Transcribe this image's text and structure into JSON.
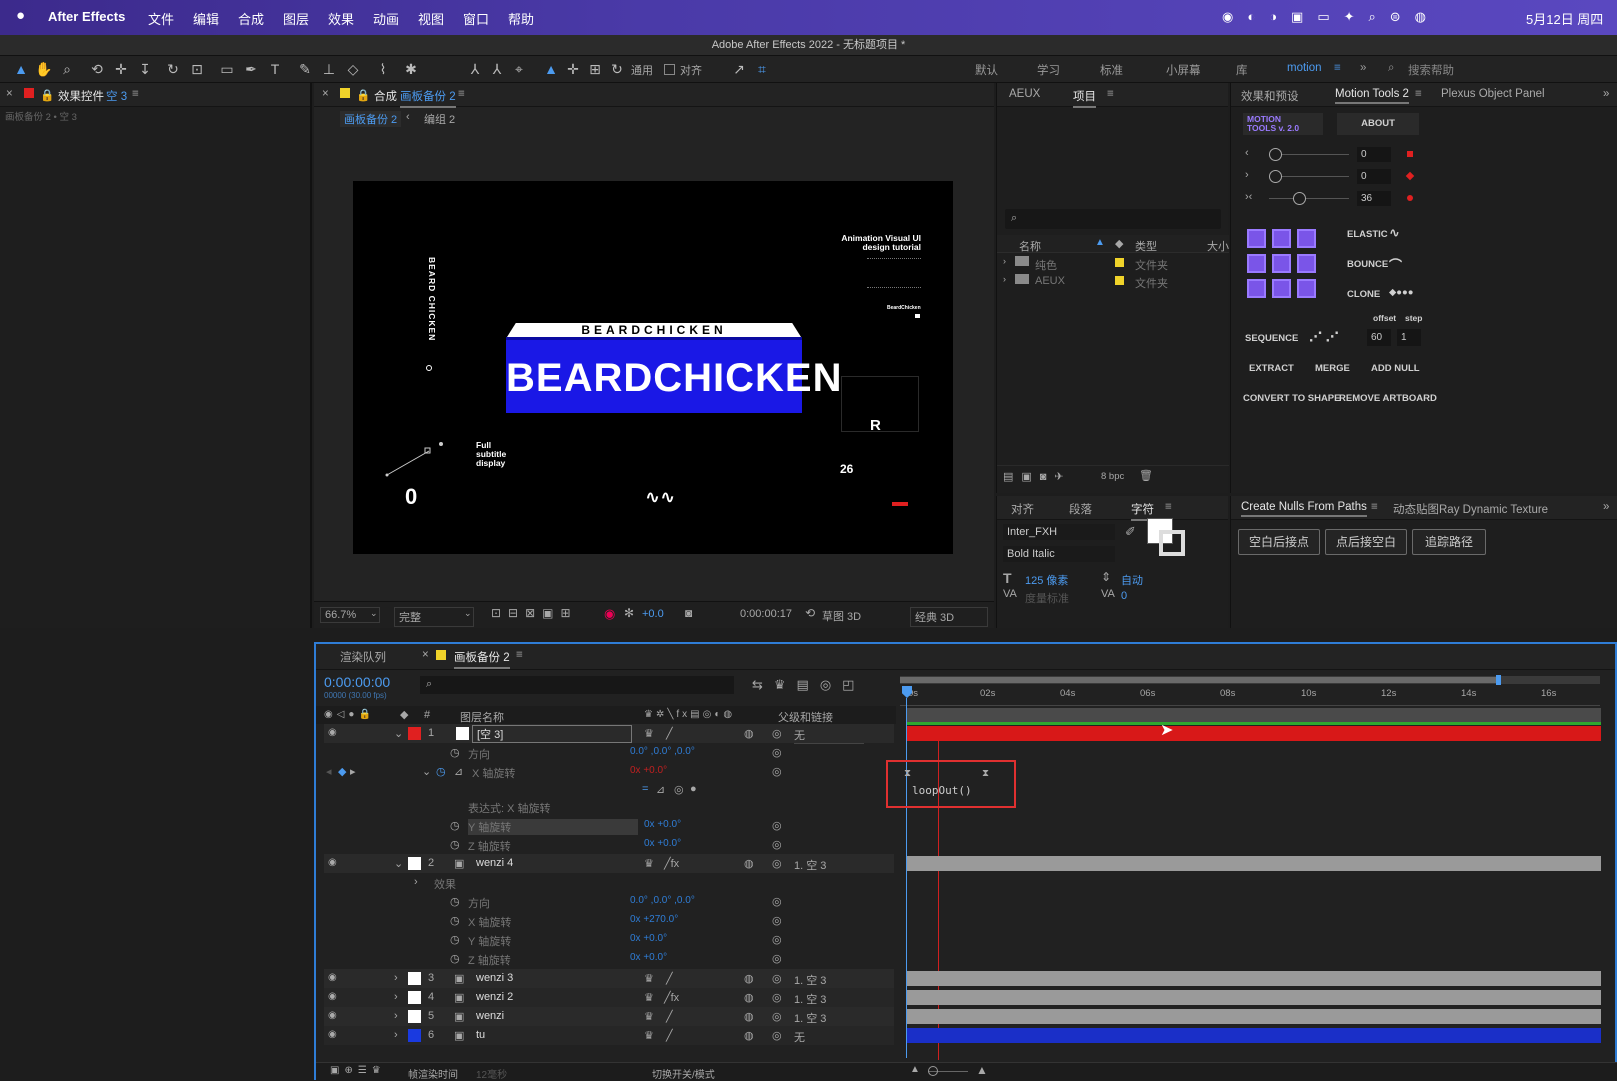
{
  "menubar": {
    "app": "After Effects",
    "items": [
      "文件",
      "编辑",
      "合成",
      "图层",
      "效果",
      "动画",
      "视图",
      "窗口",
      "帮助"
    ],
    "datetime": "5月12日 周四"
  },
  "window_title": "Adobe After Effects 2022 - 无标题项目 *",
  "toolbar": {
    "universal": "通用",
    "align": "对齐",
    "workspaces": [
      "默认",
      "学习",
      "标准",
      "小屏幕",
      "库"
    ],
    "active_workspace": "motion",
    "search_placeholder": "搜索帮助"
  },
  "effects_panel": {
    "title": "效果控件",
    "layer": "空 3",
    "breadcrumb": "画板备份 2 • 空 3"
  },
  "comp_panel": {
    "label": "合成",
    "name": "画板备份 2",
    "crumb1": "画板备份 2",
    "crumb2": "编组 2",
    "zoom": "66.7%",
    "quality": "完整",
    "exposure": "+0.0",
    "timecode": "0:00:00:17",
    "draft3d": "草图 3D",
    "renderer": "经典 3D"
  },
  "artwork": {
    "vertical_text": "BEARD CHICKEN",
    "banner_top": "BEARDCHICKEN",
    "banner_main": "BEARDCHICKEN",
    "tutorial": "Animation Visual UI design tutorial",
    "subtitle_note": "Full subtitle display",
    "num_zero": "0",
    "num_26": "26",
    "letter_r": "R",
    "brand_small": "BeardChicken"
  },
  "project_panel": {
    "tab_aeux": "AEUX",
    "tab_project": "项目",
    "col_name": "名称",
    "col_type": "类型",
    "col_size": "大小",
    "rows": [
      {
        "name": "纯色",
        "type": "文件夹"
      },
      {
        "name": "AEUX",
        "type": "文件夹"
      }
    ],
    "bpc": "8 bpc"
  },
  "char_panel": {
    "tab_align": "对齐",
    "tab_para": "段落",
    "tab_char": "字符",
    "font": "Inter_FXH",
    "style": "Bold Italic",
    "size": "125 像素",
    "leading": "自动",
    "kerning": "度量标准",
    "tracking": "0"
  },
  "motion_tools": {
    "tab_fx": "效果和预设",
    "tab_mt": "Motion Tools 2",
    "tab_plexus": "Plexus Object Panel",
    "logo_line1": "MOTION",
    "logo_line2": "TOOLS v. 2.0",
    "about": "ABOUT",
    "slider_vals": [
      "0",
      "0",
      "36"
    ],
    "elastic": "ELASTIC",
    "bounce": "BOUNCE",
    "clone": "CLONE",
    "offset": "offset",
    "step": "step",
    "sequence": "SEQUENCE",
    "seq_offset": "60",
    "seq_step": "1",
    "extract": "EXTRACT",
    "merge": "MERGE",
    "add_null": "ADD NULL",
    "convert": "CONVERT TO SHAPE",
    "remove_artboard": "REMOVE ARTBOARD"
  },
  "create_nulls": {
    "tab1": "Create Nulls From Paths",
    "tab2": "动态贴图Ray Dynamic Texture",
    "btn1": "空白后接点",
    "btn2": "点后接空白",
    "btn3": "追踪路径"
  },
  "timeline": {
    "tab_render": "渲染队列",
    "tab_comp": "画板备份 2",
    "timecode": "0:00:00:00",
    "fps": "00000 (30.00 fps)",
    "col_layer_name": "图层名称",
    "col_parent": "父级和链接",
    "ruler": [
      "0s",
      "02s",
      "04s",
      "06s",
      "08s",
      "10s",
      "12s",
      "14s",
      "16s"
    ],
    "footer_render": "帧渲染时间",
    "footer_ms": "12毫秒",
    "footer_toggle": "切换开关/模式",
    "expression": "loopOut()",
    "expr_label": "表达式: X 轴旋转",
    "layers": [
      {
        "num": "1",
        "name": "[空 3]",
        "parent": "无",
        "color": "#e02020"
      },
      {
        "num": "2",
        "name": "wenzi 4",
        "parent": "1. 空 3",
        "color": "#ffffff"
      },
      {
        "num": "3",
        "name": "wenzi 3",
        "parent": "1. 空 3",
        "color": "#ffffff"
      },
      {
        "num": "4",
        "name": "wenzi 2",
        "parent": "1. 空 3",
        "color": "#ffffff"
      },
      {
        "num": "5",
        "name": "wenzi",
        "parent": "1. 空 3",
        "color": "#ffffff"
      },
      {
        "num": "6",
        "name": "tu",
        "parent": "无",
        "color": "#1a3ae0"
      }
    ],
    "props1": [
      {
        "name": "方向",
        "value": "0.0° ,0.0° ,0.0°"
      },
      {
        "name": "X 轴旋转",
        "value": "0x +0.0°"
      },
      {
        "name": "Y 轴旋转",
        "value": "0x +0.0°"
      },
      {
        "name": "Z 轴旋转",
        "value": "0x +0.0°"
      }
    ],
    "effects_label": "效果",
    "props2": [
      {
        "name": "方向",
        "value": "0.0° ,0.0° ,0.0°"
      },
      {
        "name": "X 轴旋转",
        "value": "0x +270.0°"
      },
      {
        "name": "Y 轴旋转",
        "value": "0x +0.0°"
      },
      {
        "name": "Z 轴旋转",
        "value": "0x +0.0°"
      }
    ]
  }
}
